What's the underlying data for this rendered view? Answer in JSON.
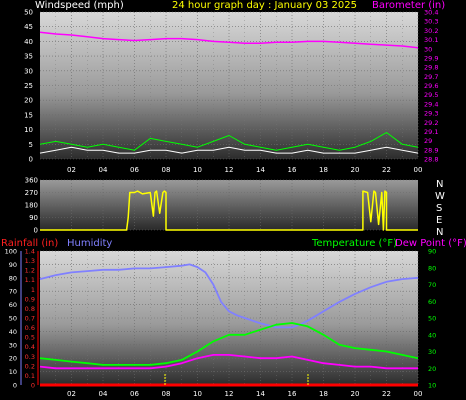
{
  "header": {
    "left_label": "Windspeed (mph)",
    "center_label": "24 hour graph day : January 03 2025",
    "right_label": "Barometer (in)"
  },
  "direction_labels": [
    "N",
    "W",
    "S",
    "E",
    "N"
  ],
  "bottom_header": {
    "rainfall_label": "Rainfall (in)",
    "humidity_label": "Humidity",
    "temperature_label": "Temperature (°F)",
    "dewpoint_label": "Dew Point (°F)"
  },
  "colors": {
    "wind": "#ffffff",
    "gust": "#00ff00",
    "barometer": "#ff00ff",
    "direction": "#ffff00",
    "rainfall": "#ff0000",
    "humidity": "#8080ff",
    "temperature": "#00ff00",
    "dewpoint": "#ff00ff",
    "ytick_left": "#ffffff",
    "ytick_rain": "#ff3030",
    "ytick_right_top": "#ff00ff",
    "ytick_right_bottom": "#00ff00",
    "ytick_dir": "#ffffff"
  },
  "chart_data": [
    {
      "type": "line",
      "title": "24 hour graph day : January 03 2025",
      "x_tick_labels": [
        "02",
        "04",
        "06",
        "08",
        "10",
        "12",
        "14",
        "16",
        "18",
        "20",
        "22",
        "00"
      ],
      "y_left": {
        "label": "Windspeed (mph)",
        "ylim": [
          0,
          50
        ],
        "ticks": [
          "0",
          "5",
          "10",
          "15",
          "20",
          "25",
          "30",
          "35",
          "40",
          "45",
          "50"
        ]
      },
      "y_right": {
        "label": "Barometer (in)",
        "ylim": [
          28.8,
          30.4
        ],
        "ticks": [
          "28.8",
          "28.9",
          "29",
          "29.1",
          "29.2",
          "29.3",
          "29.4",
          "29.5",
          "29.6",
          "29.7",
          "29.8",
          "29.9",
          "30",
          "30.1",
          "30.2",
          "30.3",
          "30.4"
        ]
      },
      "grid": true,
      "series": [
        {
          "name": "Barometer (in)",
          "axis": "right",
          "x": [
            0,
            1,
            2,
            3,
            4,
            5,
            6,
            7,
            8,
            9,
            10,
            11,
            12,
            13,
            14,
            15,
            16,
            17,
            18,
            19,
            20,
            21,
            22,
            23,
            24
          ],
          "values": [
            30.18,
            30.16,
            30.15,
            30.13,
            30.11,
            30.1,
            30.09,
            30.1,
            30.11,
            30.11,
            30.1,
            30.08,
            30.07,
            30.06,
            30.06,
            30.07,
            30.07,
            30.08,
            30.08,
            30.07,
            30.06,
            30.05,
            30.04,
            30.03,
            30.01
          ]
        },
        {
          "name": "Windspeed (mph)",
          "axis": "left",
          "x": [
            0,
            1,
            2,
            3,
            4,
            5,
            6,
            7,
            8,
            9,
            10,
            11,
            12,
            13,
            14,
            15,
            16,
            17,
            18,
            19,
            20,
            21,
            22,
            23,
            24
          ],
          "values": [
            2,
            3,
            4,
            3,
            3,
            2,
            2,
            3,
            3,
            2,
            3,
            3,
            4,
            3,
            3,
            2,
            2,
            3,
            2,
            2,
            2,
            3,
            4,
            3,
            2
          ]
        },
        {
          "name": "Gust",
          "axis": "left",
          "x": [
            0,
            1,
            2,
            3,
            4,
            5,
            6,
            7,
            8,
            9,
            10,
            11,
            12,
            13,
            14,
            15,
            16,
            17,
            18,
            19,
            20,
            21,
            22,
            23,
            24
          ],
          "values": [
            5,
            6,
            5,
            4,
            5,
            4,
            3,
            7,
            6,
            5,
            4,
            6,
            8,
            5,
            4,
            3,
            4,
            5,
            4,
            3,
            4,
            6,
            9,
            5,
            4
          ]
        }
      ]
    },
    {
      "type": "line",
      "x_tick_labels": [],
      "y_left": {
        "ylim": [
          0,
          360
        ],
        "ticks": [
          "0",
          "90",
          "180",
          "270",
          "360"
        ]
      },
      "y_right": {
        "labels": [
          "N",
          "W",
          "S",
          "E",
          "N"
        ]
      },
      "grid": true,
      "series": [
        {
          "name": "Wind Direction",
          "x": [
            0,
            5.5,
            5.6,
            5.7,
            6.0,
            6.2,
            6.5,
            7.0,
            7.2,
            7.3,
            7.4,
            7.6,
            7.8,
            7.9,
            8.0,
            8.0,
            20.5,
            20.5,
            20.8,
            21.0,
            21.2,
            21.3,
            21.5,
            21.7,
            21.8,
            21.9,
            22.0,
            22.0,
            24
          ],
          "values": [
            0,
            0,
            90,
            270,
            270,
            280,
            260,
            270,
            100,
            270,
            280,
            120,
            270,
            280,
            270,
            0,
            0,
            280,
            270,
            60,
            280,
            270,
            40,
            270,
            0,
            280,
            270,
            0,
            0
          ]
        }
      ]
    },
    {
      "type": "line",
      "x_tick_labels": [
        "02",
        "04",
        "06",
        "08",
        "10",
        "12",
        "14",
        "16",
        "18",
        "20",
        "22",
        "00"
      ],
      "y_left_humidity": {
        "label": "Humidity",
        "ylim": [
          0,
          100
        ],
        "ticks": [
          "0",
          "10",
          "20",
          "30",
          "40",
          "50",
          "60",
          "70",
          "80",
          "90",
          "100"
        ]
      },
      "y_left_rain": {
        "label": "Rainfall (in)",
        "ylim": [
          0,
          1.4
        ],
        "ticks": [
          "0",
          "0.1",
          "0.2",
          "0.3",
          "0.4",
          "0.5",
          "0.6",
          "0.7",
          "0.8",
          "0.9",
          "1",
          "1.1",
          "1.2",
          "1.3",
          "1.4"
        ]
      },
      "y_right": {
        "label": "Temperature (°F)",
        "ylim": [
          10,
          90
        ],
        "ticks": [
          "10",
          "20",
          "30",
          "40",
          "50",
          "60",
          "70",
          "80",
          "90"
        ]
      },
      "grid": true,
      "series": [
        {
          "name": "Humidity",
          "axis": "humidity",
          "x": [
            0,
            1,
            2,
            3,
            4,
            5,
            6,
            7,
            8,
            9,
            9.5,
            10,
            10.5,
            11,
            11.5,
            12,
            12.5,
            13,
            13.5,
            14,
            15,
            16,
            16.5,
            17,
            18,
            19,
            20,
            21,
            22,
            23,
            24
          ],
          "values": [
            79,
            82,
            84,
            85,
            86,
            86,
            87,
            87,
            88,
            89,
            90,
            88,
            84,
            75,
            62,
            55,
            52,
            50,
            48,
            46,
            43,
            43,
            45,
            48,
            55,
            62,
            68,
            73,
            77,
            79,
            80
          ]
        },
        {
          "name": "Temperature (°F)",
          "axis": "right",
          "x": [
            0,
            1,
            2,
            3,
            4,
            5,
            6,
            7,
            8,
            9,
            10,
            11,
            12,
            13,
            14,
            15,
            16,
            17,
            18,
            19,
            20,
            21,
            22,
            23,
            24
          ],
          "values": [
            26,
            25,
            24,
            23,
            22,
            22,
            22,
            22,
            23,
            25,
            30,
            36,
            40,
            40,
            43,
            46,
            47,
            45,
            40,
            34,
            32,
            31,
            30,
            28,
            26
          ]
        },
        {
          "name": "Dew Point (°F)",
          "axis": "right",
          "x": [
            0,
            1,
            2,
            3,
            4,
            5,
            6,
            7,
            8,
            9,
            10,
            11,
            12,
            13,
            14,
            15,
            16,
            17,
            18,
            19,
            20,
            21,
            22,
            23,
            24
          ],
          "values": [
            21,
            20,
            20,
            20,
            20,
            20,
            20,
            20,
            21,
            23,
            26,
            28,
            28,
            27,
            26,
            26,
            27,
            25,
            23,
            22,
            21,
            21,
            20,
            20,
            20
          ]
        },
        {
          "name": "Rainfall (in)",
          "axis": "rain",
          "x": [
            0,
            24
          ],
          "values": [
            0,
            0
          ]
        }
      ]
    }
  ]
}
